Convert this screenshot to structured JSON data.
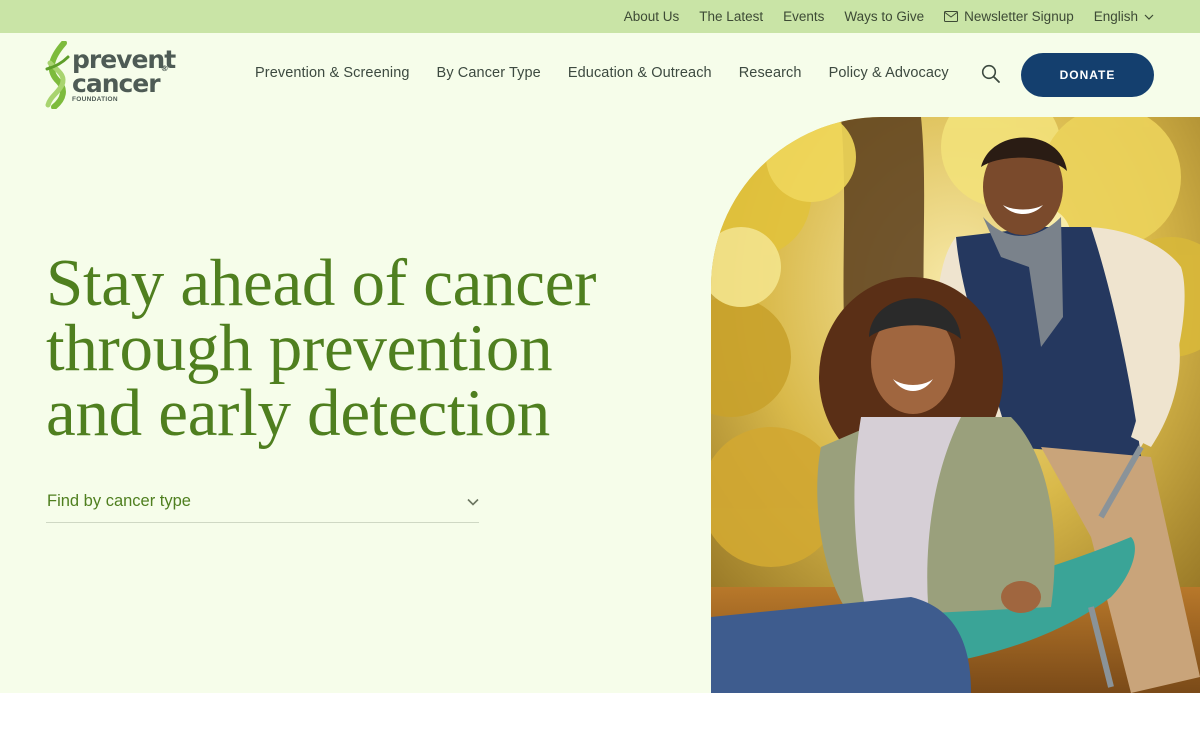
{
  "utility_nav": {
    "items": [
      "About Us",
      "The Latest",
      "Events",
      "Ways to Give",
      "Newsletter Signup"
    ],
    "language": "English"
  },
  "logo": {
    "line1": "prevent",
    "line2": "cancer",
    "trademark": "®",
    "subline": "FOUNDATION"
  },
  "main_nav": {
    "items": [
      "Prevention & Screening",
      "By Cancer Type",
      "Education & Outreach",
      "Research",
      "Policy & Advocacy"
    ]
  },
  "donate_label": "DONATE",
  "hero": {
    "title_line1": "Stay ahead of cancer",
    "title_line2": "through prevention",
    "title_line3": "and early detection",
    "select_label": "Find by cancer type"
  },
  "colors": {
    "utility_bg": "#c9e4a6",
    "page_bg": "#f6fdea",
    "brand_green": "#4f7f1f",
    "donate_bg": "#143f6e"
  },
  "icons": [
    "mail-icon",
    "chevron-down-icon",
    "search-icon",
    "ribbon-logo-icon"
  ]
}
